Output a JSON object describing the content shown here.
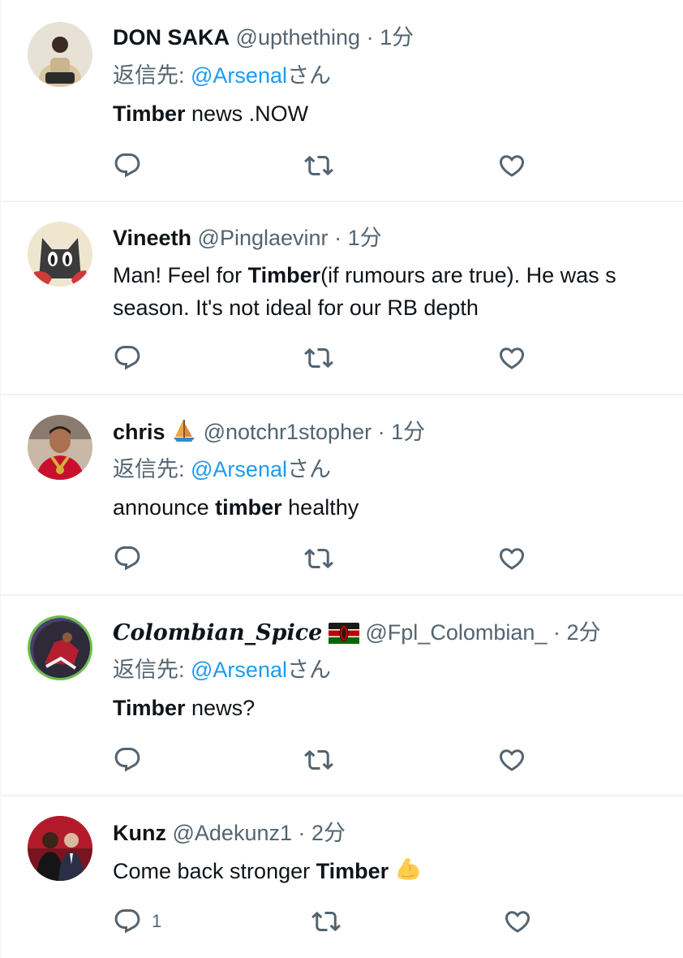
{
  "tweets": [
    {
      "name": "DON SAKA",
      "handle": "@upthething",
      "sep": "·",
      "time": "1分",
      "reply_prefix": "返信先: ",
      "reply_to": "@Arsenal",
      "reply_suffix": "さん",
      "body_bold": "Timber",
      "body_rest": " news .NOW",
      "avatar": "person-avatar"
    },
    {
      "name": "Vineeth",
      "handle": "@Pinglaevinr",
      "sep": "·",
      "time": "1分",
      "body_pre": "Man! Feel for ",
      "body_bold": "Timber",
      "body_post": "(if rumours are true). He was s",
      "body_line2": "season. It's not ideal for our RB depth",
      "avatar": "cat-avatar"
    },
    {
      "name": "chris",
      "name_emoji": "sailboat-emoji",
      "handle": "@notchr1stopher",
      "sep": "·",
      "time": "1分",
      "reply_prefix": "返信先: ",
      "reply_to": "@Arsenal",
      "reply_suffix": "さん",
      "body_pre": "announce ",
      "body_bold": "timber",
      "body_post": " healthy",
      "avatar": "player-avatar"
    },
    {
      "name": "𝑪𝒐𝒍𝒐𝒎𝒃𝒊𝒂𝒏_𝑺𝒑𝒊𝒄𝒆",
      "name_emoji": "kenya-flag-emoji",
      "handle": "@Fpl_Colombian_",
      "sep": "·",
      "time": "2分",
      "reply_prefix": "返信先: ",
      "reply_to": "@Arsenal",
      "reply_suffix": "さん",
      "body_bold": "Timber",
      "body_rest": " news?",
      "avatar": "football-avatar"
    },
    {
      "name": "Kunz",
      "handle": "@Adekunz1",
      "sep": "·",
      "time": "2分",
      "body_pre": "Come back stronger ",
      "body_bold": "Timber",
      "body_emoji": "flexed-biceps-emoji",
      "reply_count": "1",
      "avatar": "two-men-avatar"
    }
  ],
  "icons": {
    "reply": "reply-icon",
    "retweet": "retweet-icon",
    "like": "like-icon"
  },
  "colors": {
    "mention": "#1d9bf0",
    "secondary_text": "#536471",
    "icon": "#536471",
    "divider": "#eff3f4"
  }
}
